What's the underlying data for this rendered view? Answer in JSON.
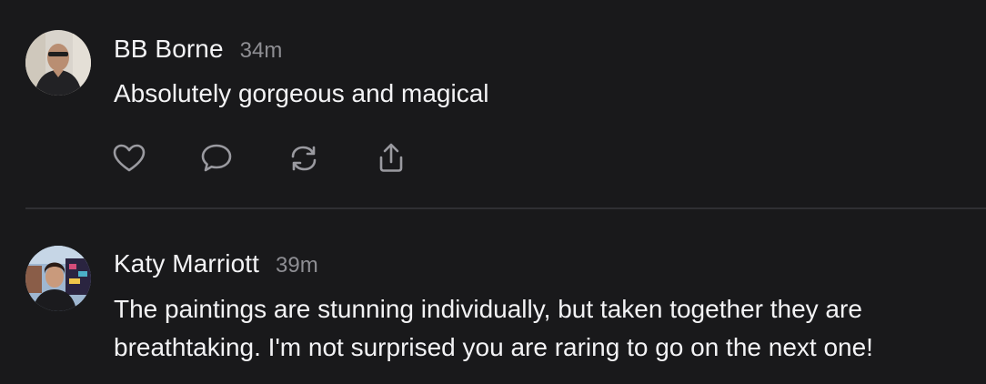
{
  "posts": [
    {
      "author": "BB Borne",
      "time": "34m",
      "lines": [
        "Absolutely gorgeous and magical"
      ],
      "actions": [
        {
          "name": "like",
          "icon": "heart-icon"
        },
        {
          "name": "reply",
          "icon": "comment-icon"
        },
        {
          "name": "repost",
          "icon": "repost-icon"
        },
        {
          "name": "share",
          "icon": "share-icon"
        }
      ]
    },
    {
      "author": "Katy Marriott",
      "time": "39m",
      "lines": [
        "The paintings are stunning individually, but taken together they are",
        "breathtaking. I'm not surprised you are raring to go on the next one!"
      ]
    }
  ],
  "colors": {
    "background": "#19191b",
    "text": "#f3f3f5",
    "muted": "#8e8e93",
    "divider": "#2f2f33"
  }
}
